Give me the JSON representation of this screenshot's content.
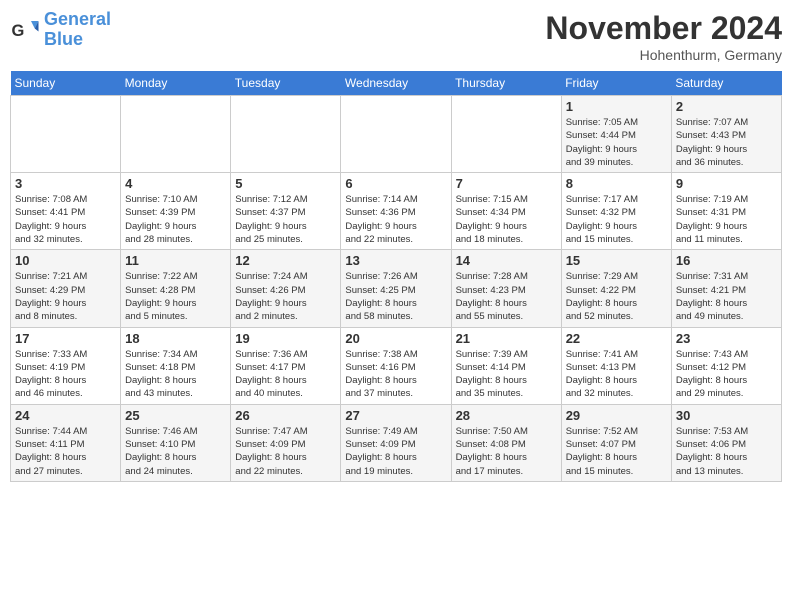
{
  "header": {
    "logo_line1": "General",
    "logo_line2": "Blue",
    "month": "November 2024",
    "location": "Hohenthurm, Germany"
  },
  "weekdays": [
    "Sunday",
    "Monday",
    "Tuesday",
    "Wednesday",
    "Thursday",
    "Friday",
    "Saturday"
  ],
  "weeks": [
    [
      {
        "day": "",
        "info": ""
      },
      {
        "day": "",
        "info": ""
      },
      {
        "day": "",
        "info": ""
      },
      {
        "day": "",
        "info": ""
      },
      {
        "day": "",
        "info": ""
      },
      {
        "day": "1",
        "info": "Sunrise: 7:05 AM\nSunset: 4:44 PM\nDaylight: 9 hours\nand 39 minutes."
      },
      {
        "day": "2",
        "info": "Sunrise: 7:07 AM\nSunset: 4:43 PM\nDaylight: 9 hours\nand 36 minutes."
      }
    ],
    [
      {
        "day": "3",
        "info": "Sunrise: 7:08 AM\nSunset: 4:41 PM\nDaylight: 9 hours\nand 32 minutes."
      },
      {
        "day": "4",
        "info": "Sunrise: 7:10 AM\nSunset: 4:39 PM\nDaylight: 9 hours\nand 28 minutes."
      },
      {
        "day": "5",
        "info": "Sunrise: 7:12 AM\nSunset: 4:37 PM\nDaylight: 9 hours\nand 25 minutes."
      },
      {
        "day": "6",
        "info": "Sunrise: 7:14 AM\nSunset: 4:36 PM\nDaylight: 9 hours\nand 22 minutes."
      },
      {
        "day": "7",
        "info": "Sunrise: 7:15 AM\nSunset: 4:34 PM\nDaylight: 9 hours\nand 18 minutes."
      },
      {
        "day": "8",
        "info": "Sunrise: 7:17 AM\nSunset: 4:32 PM\nDaylight: 9 hours\nand 15 minutes."
      },
      {
        "day": "9",
        "info": "Sunrise: 7:19 AM\nSunset: 4:31 PM\nDaylight: 9 hours\nand 11 minutes."
      }
    ],
    [
      {
        "day": "10",
        "info": "Sunrise: 7:21 AM\nSunset: 4:29 PM\nDaylight: 9 hours\nand 8 minutes."
      },
      {
        "day": "11",
        "info": "Sunrise: 7:22 AM\nSunset: 4:28 PM\nDaylight: 9 hours\nand 5 minutes."
      },
      {
        "day": "12",
        "info": "Sunrise: 7:24 AM\nSunset: 4:26 PM\nDaylight: 9 hours\nand 2 minutes."
      },
      {
        "day": "13",
        "info": "Sunrise: 7:26 AM\nSunset: 4:25 PM\nDaylight: 8 hours\nand 58 minutes."
      },
      {
        "day": "14",
        "info": "Sunrise: 7:28 AM\nSunset: 4:23 PM\nDaylight: 8 hours\nand 55 minutes."
      },
      {
        "day": "15",
        "info": "Sunrise: 7:29 AM\nSunset: 4:22 PM\nDaylight: 8 hours\nand 52 minutes."
      },
      {
        "day": "16",
        "info": "Sunrise: 7:31 AM\nSunset: 4:21 PM\nDaylight: 8 hours\nand 49 minutes."
      }
    ],
    [
      {
        "day": "17",
        "info": "Sunrise: 7:33 AM\nSunset: 4:19 PM\nDaylight: 8 hours\nand 46 minutes."
      },
      {
        "day": "18",
        "info": "Sunrise: 7:34 AM\nSunset: 4:18 PM\nDaylight: 8 hours\nand 43 minutes."
      },
      {
        "day": "19",
        "info": "Sunrise: 7:36 AM\nSunset: 4:17 PM\nDaylight: 8 hours\nand 40 minutes."
      },
      {
        "day": "20",
        "info": "Sunrise: 7:38 AM\nSunset: 4:16 PM\nDaylight: 8 hours\nand 37 minutes."
      },
      {
        "day": "21",
        "info": "Sunrise: 7:39 AM\nSunset: 4:14 PM\nDaylight: 8 hours\nand 35 minutes."
      },
      {
        "day": "22",
        "info": "Sunrise: 7:41 AM\nSunset: 4:13 PM\nDaylight: 8 hours\nand 32 minutes."
      },
      {
        "day": "23",
        "info": "Sunrise: 7:43 AM\nSunset: 4:12 PM\nDaylight: 8 hours\nand 29 minutes."
      }
    ],
    [
      {
        "day": "24",
        "info": "Sunrise: 7:44 AM\nSunset: 4:11 PM\nDaylight: 8 hours\nand 27 minutes."
      },
      {
        "day": "25",
        "info": "Sunrise: 7:46 AM\nSunset: 4:10 PM\nDaylight: 8 hours\nand 24 minutes."
      },
      {
        "day": "26",
        "info": "Sunrise: 7:47 AM\nSunset: 4:09 PM\nDaylight: 8 hours\nand 22 minutes."
      },
      {
        "day": "27",
        "info": "Sunrise: 7:49 AM\nSunset: 4:09 PM\nDaylight: 8 hours\nand 19 minutes."
      },
      {
        "day": "28",
        "info": "Sunrise: 7:50 AM\nSunset: 4:08 PM\nDaylight: 8 hours\nand 17 minutes."
      },
      {
        "day": "29",
        "info": "Sunrise: 7:52 AM\nSunset: 4:07 PM\nDaylight: 8 hours\nand 15 minutes."
      },
      {
        "day": "30",
        "info": "Sunrise: 7:53 AM\nSunset: 4:06 PM\nDaylight: 8 hours\nand 13 minutes."
      }
    ]
  ]
}
